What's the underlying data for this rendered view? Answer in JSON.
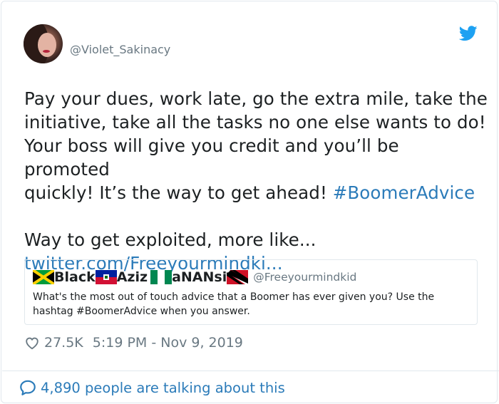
{
  "tweet": {
    "handle": "@Violet_Sakinacy",
    "text_line1": "Pay your dues, work late, go the extra mile, take the",
    "text_line2": "initiative, take all the tasks no one else wants to do!",
    "text_line3": "Your boss will give you credit and you’ll be promoted",
    "text_line4": "quickly! It’s the way to get ahead! ",
    "hashtag": "#BoomerAdvice",
    "text_line5": "Way to get exploited, more like...",
    "link": "twitter.com/Freeyourmindki..."
  },
  "quote": {
    "name_part1": "Black",
    "name_part2": "Aziz",
    "name_part3": "aNANsi",
    "handle": "@Freeyourmindkid",
    "flags": [
      "jamaica-flag",
      "haiti-flag",
      "nigeria-flag",
      "trinidad-flag"
    ],
    "body": "What's the most out of touch advice that a Boomer has ever given you? Use the hashtag #BoomerAdvice when you answer."
  },
  "meta": {
    "likes": "27.5K",
    "timestamp": "5:19 PM - Nov 9, 2019"
  },
  "footer": {
    "conversation": "4,890 people are talking about this"
  },
  "icons": {
    "brand": "twitter-bird-icon",
    "like": "heart-icon",
    "reply": "speech-bubble-icon"
  },
  "colors": {
    "link": "#2b7bb9",
    "muted": "#697882",
    "text": "#1c2022",
    "border": "#e1e8ed",
    "twitter_blue": "#1da1f2"
  }
}
